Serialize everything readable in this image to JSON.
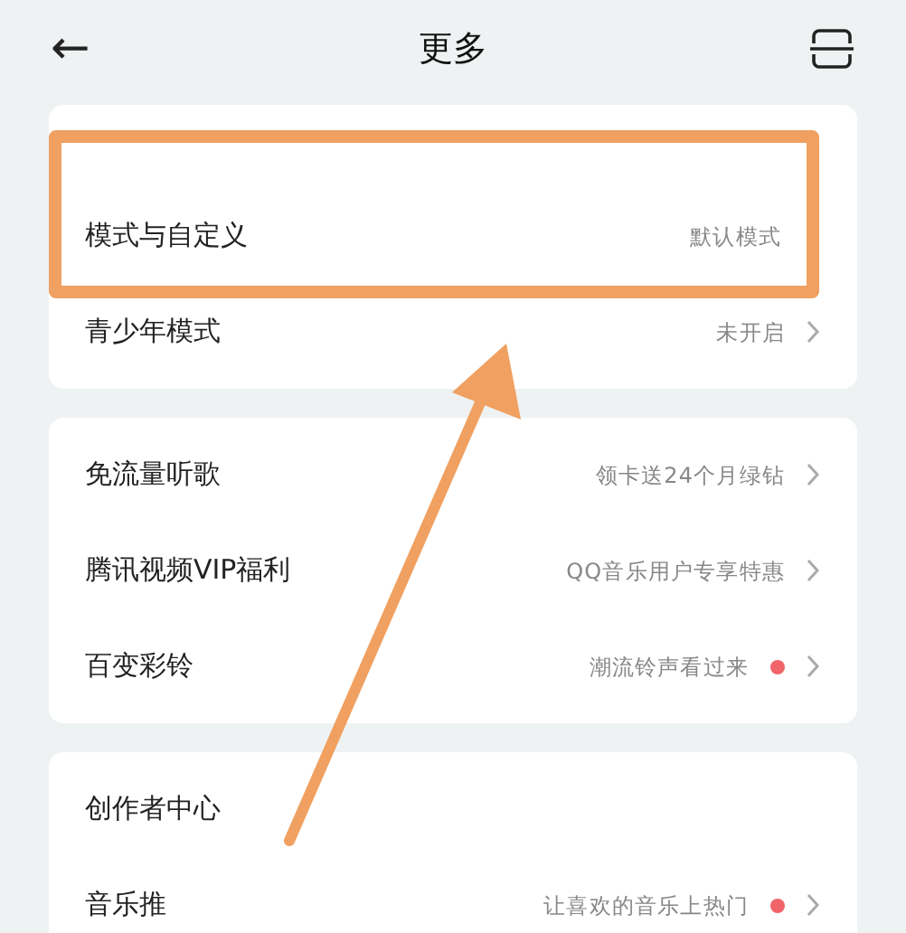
{
  "header": {
    "back": "←",
    "title": "更多"
  },
  "groups": [
    {
      "items": [
        {
          "label": "模式与自定义",
          "value": "默认模式",
          "chevron": false,
          "dot": false,
          "highlighted": true
        },
        {
          "label": "青少年模式",
          "value": "未开启",
          "chevron": true,
          "dot": false,
          "highlighted": false
        }
      ]
    },
    {
      "items": [
        {
          "label": "免流量听歌",
          "value": "领卡送24个月绿钻",
          "chevron": true,
          "dot": false,
          "highlighted": false
        },
        {
          "label": "腾讯视频VIP福利",
          "value": "QQ音乐用户专享特惠",
          "chevron": true,
          "dot": false,
          "highlighted": false
        },
        {
          "label": "百变彩铃",
          "value": "潮流铃声看过来",
          "chevron": true,
          "dot": true,
          "highlighted": false
        }
      ]
    },
    {
      "items": [
        {
          "label": "创作者中心",
          "value": "",
          "chevron": false,
          "dot": false,
          "highlighted": false
        },
        {
          "label": "音乐推",
          "value": "让喜欢的音乐上热门",
          "chevron": true,
          "dot": true,
          "highlighted": false
        }
      ]
    }
  ]
}
